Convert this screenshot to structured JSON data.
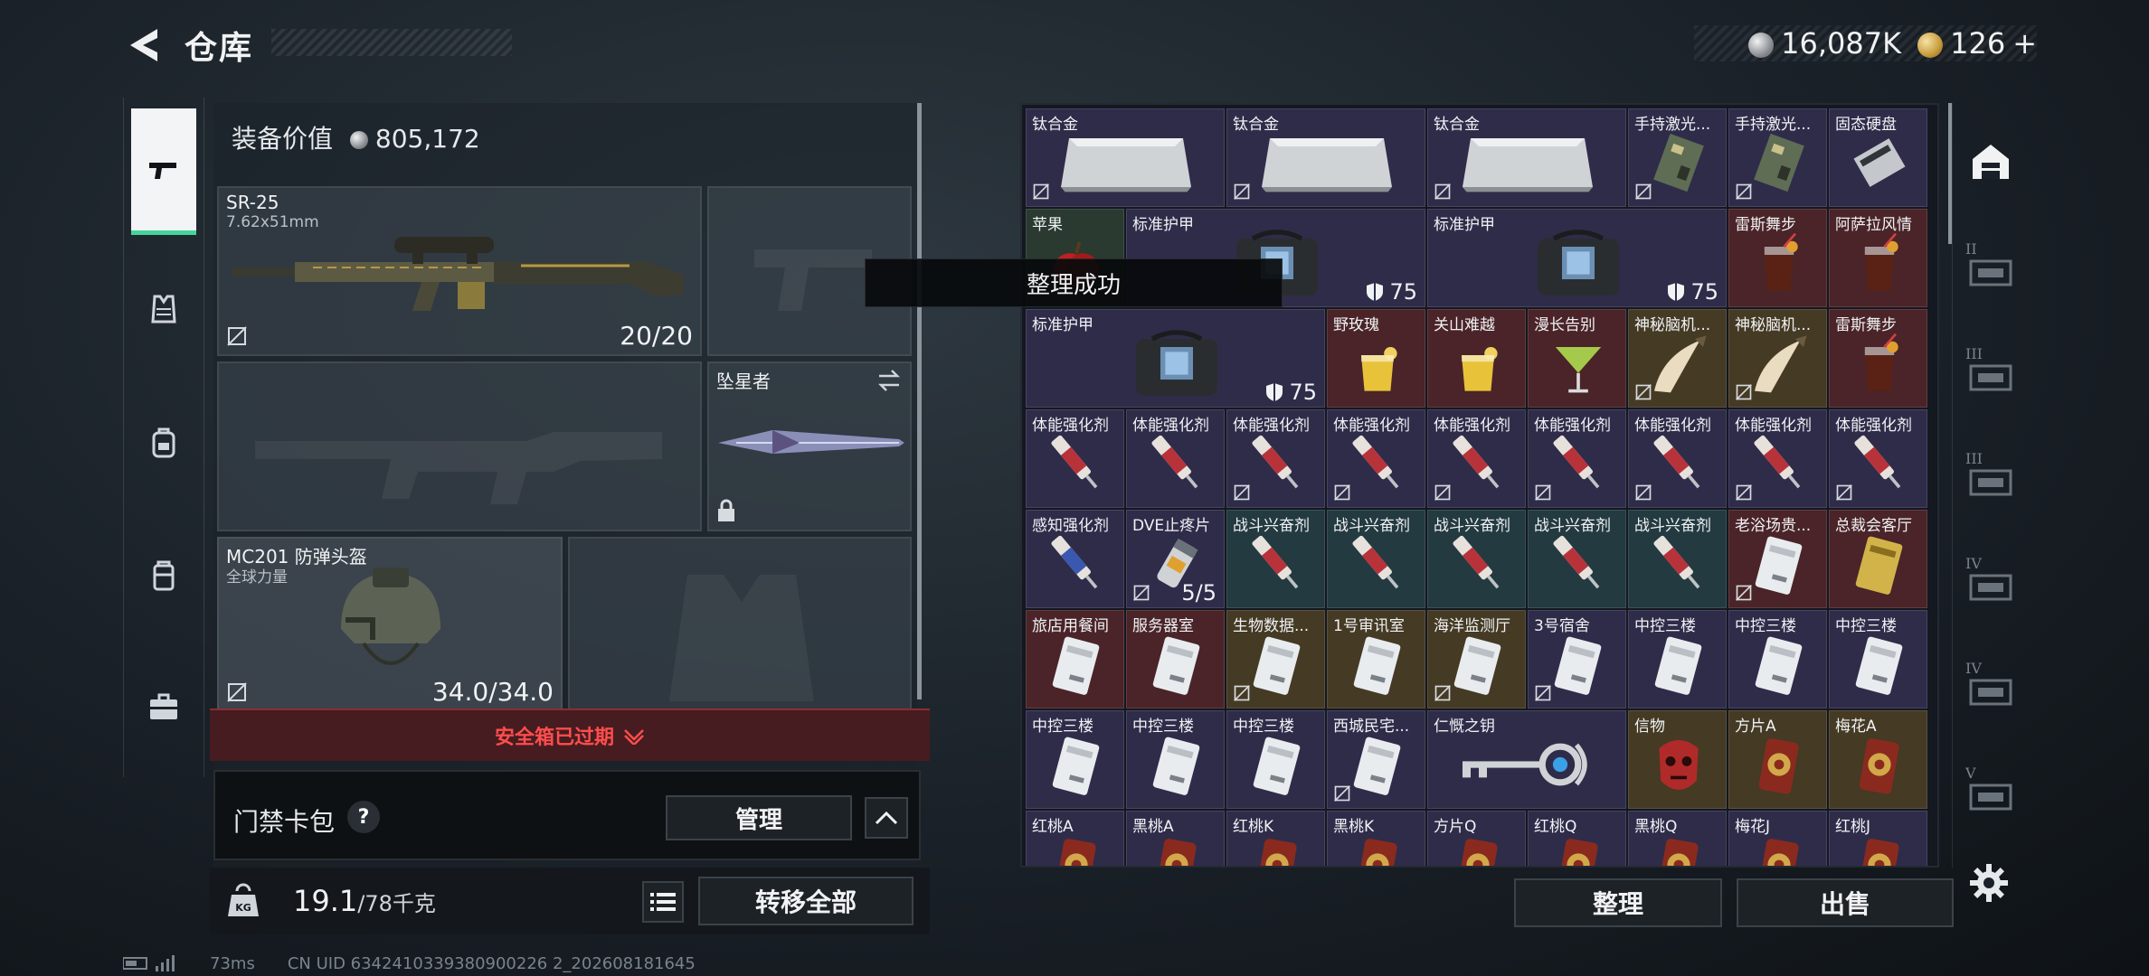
{
  "header": {
    "title": "仓库",
    "currency_silver": "16,087K",
    "currency_gold": "126",
    "add_symbol": "+"
  },
  "left_nav": [
    {
      "name": "weapon",
      "icon": "pistol-icon",
      "active": true
    },
    {
      "name": "armor",
      "icon": "vest-icon",
      "active": false
    },
    {
      "name": "backpack",
      "icon": "backpack-icon",
      "active": false
    },
    {
      "name": "rig",
      "icon": "rig-icon",
      "active": false
    },
    {
      "name": "case",
      "icon": "briefcase-icon",
      "active": false
    }
  ],
  "loadout": {
    "equip_value_label": "装备价值",
    "equip_value": "805,172",
    "primary": {
      "name": "SR-25",
      "caliber": "7.62x51mm",
      "ammo": "20/20"
    },
    "melee": {
      "name": "坠星者"
    },
    "helmet": {
      "name": "MC201 防弹头盔",
      "sub": "全球力量",
      "durability": "34.0/34.0"
    }
  },
  "safebox": {
    "label": "安全箱已过期"
  },
  "keycard": {
    "label": "门禁卡包",
    "help": "?",
    "manage": "管理"
  },
  "capacity": {
    "weight": "19.1",
    "max": "/78千克",
    "transfer_all": "转移全部"
  },
  "storage": {
    "toast": "整理成功",
    "sort": "整理",
    "sell": "出售",
    "items": [
      {
        "name": "钛合金",
        "count": "",
        "bg": "purple",
        "pic": "ingot",
        "noshare": true,
        "col": 0,
        "row": 0,
        "w": 2,
        "h": 1
      },
      {
        "name": "钛合金",
        "count": "",
        "bg": "purple",
        "pic": "ingot",
        "noshare": true,
        "col": 2,
        "row": 0,
        "w": 2,
        "h": 1
      },
      {
        "name": "钛合金",
        "count": "",
        "bg": "purple",
        "pic": "ingot",
        "noshare": true,
        "col": 4,
        "row": 0,
        "w": 2,
        "h": 1
      },
      {
        "name": "手持激光...",
        "count": "",
        "bg": "purple",
        "pic": "board",
        "noshare": true,
        "col": 6,
        "row": 0,
        "w": 1,
        "h": 1
      },
      {
        "name": "手持激光...",
        "count": "",
        "bg": "purple",
        "pic": "board",
        "noshare": true,
        "col": 7,
        "row": 0,
        "w": 1,
        "h": 1
      },
      {
        "name": "固态硬盘",
        "count": "",
        "bg": "purple",
        "pic": "ssd",
        "noshare": false,
        "col": 8,
        "row": 0,
        "w": 1,
        "h": 1
      },
      {
        "name": "苹果",
        "count": "",
        "bg": "green",
        "pic": "apple",
        "noshare": false,
        "col": 0,
        "row": 1,
        "w": 1,
        "h": 1
      },
      {
        "name": "标准护甲",
        "count": "75",
        "bg": "purple",
        "pic": "armor",
        "noshare": false,
        "col": 1,
        "row": 1,
        "w": 3,
        "h": 1
      },
      {
        "name": "标准护甲",
        "count": "75",
        "bg": "purple",
        "pic": "armor",
        "noshare": false,
        "col": 4,
        "row": 1,
        "w": 3,
        "h": 1
      },
      {
        "name": "雷斯舞步",
        "count": "",
        "bg": "red",
        "pic": "cocktail-dark",
        "noshare": false,
        "col": 7,
        "row": 1,
        "w": 1,
        "h": 1
      },
      {
        "name": "阿萨拉风情",
        "count": "",
        "bg": "red",
        "pic": "cocktail-dark",
        "noshare": false,
        "col": 8,
        "row": 1,
        "w": 1,
        "h": 1
      },
      {
        "name": "标准护甲",
        "count": "75",
        "bg": "purple",
        "pic": "armor",
        "noshare": false,
        "col": 0,
        "row": 2,
        "w": 3,
        "h": 1
      },
      {
        "name": "野玫瑰",
        "count": "",
        "bg": "red",
        "pic": "cocktail-yellow",
        "noshare": false,
        "col": 3,
        "row": 2,
        "w": 1,
        "h": 1
      },
      {
        "name": "关山难越",
        "count": "",
        "bg": "red",
        "pic": "cocktail-yellow",
        "noshare": false,
        "col": 4,
        "row": 2,
        "w": 1,
        "h": 1
      },
      {
        "name": "漫长告别",
        "count": "",
        "bg": "red",
        "pic": "martini",
        "noshare": false,
        "col": 5,
        "row": 2,
        "w": 1,
        "h": 1
      },
      {
        "name": "神秘脑机...",
        "count": "",
        "bg": "gold",
        "pic": "horn",
        "noshare": true,
        "col": 6,
        "row": 2,
        "w": 1,
        "h": 1
      },
      {
        "name": "神秘脑机...",
        "count": "",
        "bg": "gold",
        "pic": "horn",
        "noshare": true,
        "col": 7,
        "row": 2,
        "w": 1,
        "h": 1
      },
      {
        "name": "雷斯舞步",
        "count": "",
        "bg": "red",
        "pic": "cocktail-dark",
        "noshare": false,
        "col": 8,
        "row": 2,
        "w": 1,
        "h": 1
      },
      {
        "name": "体能强化剂",
        "count": "",
        "bg": "purple",
        "pic": "syringe-red",
        "noshare": false,
        "col": 0,
        "row": 3,
        "w": 1,
        "h": 1
      },
      {
        "name": "体能强化剂",
        "count": "",
        "bg": "purple",
        "pic": "syringe-red",
        "noshare": false,
        "col": 1,
        "row": 3,
        "w": 1,
        "h": 1
      },
      {
        "name": "体能强化剂",
        "count": "",
        "bg": "purple",
        "pic": "syringe-red",
        "noshare": true,
        "col": 2,
        "row": 3,
        "w": 1,
        "h": 1
      },
      {
        "name": "体能强化剂",
        "count": "",
        "bg": "purple",
        "pic": "syringe-red",
        "noshare": true,
        "col": 3,
        "row": 3,
        "w": 1,
        "h": 1
      },
      {
        "name": "体能强化剂",
        "count": "",
        "bg": "purple",
        "pic": "syringe-red",
        "noshare": true,
        "col": 4,
        "row": 3,
        "w": 1,
        "h": 1
      },
      {
        "name": "体能强化剂",
        "count": "",
        "bg": "purple",
        "pic": "syringe-red",
        "noshare": true,
        "col": 5,
        "row": 3,
        "w": 1,
        "h": 1
      },
      {
        "name": "体能强化剂",
        "count": "",
        "bg": "purple",
        "pic": "syringe-red",
        "noshare": true,
        "col": 6,
        "row": 3,
        "w": 1,
        "h": 1
      },
      {
        "name": "体能强化剂",
        "count": "",
        "bg": "purple",
        "pic": "syringe-red",
        "noshare": true,
        "col": 7,
        "row": 3,
        "w": 1,
        "h": 1
      },
      {
        "name": "体能强化剂",
        "count": "",
        "bg": "purple",
        "pic": "syringe-red",
        "noshare": true,
        "col": 8,
        "row": 3,
        "w": 1,
        "h": 1
      },
      {
        "name": "感知强化剂",
        "count": "",
        "bg": "purple",
        "pic": "syringe-blue",
        "noshare": false,
        "col": 0,
        "row": 4,
        "w": 1,
        "h": 1
      },
      {
        "name": "DVE止疼片",
        "count": "5/5",
        "bg": "purple",
        "pic": "pills",
        "noshare": true,
        "col": 1,
        "row": 4,
        "w": 1,
        "h": 1
      },
      {
        "name": "战斗兴奋剂",
        "count": "",
        "bg": "teal",
        "pic": "syringe-red",
        "noshare": false,
        "col": 2,
        "row": 4,
        "w": 1,
        "h": 1
      },
      {
        "name": "战斗兴奋剂",
        "count": "",
        "bg": "teal",
        "pic": "syringe-red",
        "noshare": false,
        "col": 3,
        "row": 4,
        "w": 1,
        "h": 1
      },
      {
        "name": "战斗兴奋剂",
        "count": "",
        "bg": "teal",
        "pic": "syringe-red",
        "noshare": false,
        "col": 4,
        "row": 4,
        "w": 1,
        "h": 1
      },
      {
        "name": "战斗兴奋剂",
        "count": "",
        "bg": "teal",
        "pic": "syringe-red",
        "noshare": false,
        "col": 5,
        "row": 4,
        "w": 1,
        "h": 1
      },
      {
        "name": "战斗兴奋剂",
        "count": "",
        "bg": "teal",
        "pic": "syringe-red",
        "noshare": false,
        "col": 6,
        "row": 4,
        "w": 1,
        "h": 1
      },
      {
        "name": "老浴场贵...",
        "count": "",
        "bg": "red",
        "pic": "card-white",
        "noshare": true,
        "col": 7,
        "row": 4,
        "w": 1,
        "h": 1
      },
      {
        "name": "总裁会客厅",
        "count": "",
        "bg": "red",
        "pic": "card-gold",
        "noshare": false,
        "col": 8,
        "row": 4,
        "w": 1,
        "h": 1
      },
      {
        "name": "旅店用餐间",
        "count": "",
        "bg": "red",
        "pic": "card-white",
        "noshare": false,
        "col": 0,
        "row": 5,
        "w": 1,
        "h": 1
      },
      {
        "name": "服务器室",
        "count": "",
        "bg": "red",
        "pic": "card-white",
        "noshare": false,
        "col": 1,
        "row": 5,
        "w": 1,
        "h": 1
      },
      {
        "name": "生物数据...",
        "count": "",
        "bg": "gold",
        "pic": "card-white",
        "noshare": true,
        "col": 2,
        "row": 5,
        "w": 1,
        "h": 1
      },
      {
        "name": "1号审讯室",
        "count": "",
        "bg": "gold",
        "pic": "card-white",
        "noshare": false,
        "col": 3,
        "row": 5,
        "w": 1,
        "h": 1
      },
      {
        "name": "海洋监测厅",
        "count": "",
        "bg": "gold",
        "pic": "card-white",
        "noshare": true,
        "col": 4,
        "row": 5,
        "w": 1,
        "h": 1
      },
      {
        "name": "3号宿舍",
        "count": "",
        "bg": "purple",
        "pic": "card-white",
        "noshare": true,
        "col": 5,
        "row": 5,
        "w": 1,
        "h": 1
      },
      {
        "name": "中控三楼",
        "count": "",
        "bg": "purple",
        "pic": "card-white",
        "noshare": false,
        "col": 6,
        "row": 5,
        "w": 1,
        "h": 1
      },
      {
        "name": "中控三楼",
        "count": "",
        "bg": "purple",
        "pic": "card-white",
        "noshare": false,
        "col": 7,
        "row": 5,
        "w": 1,
        "h": 1
      },
      {
        "name": "中控三楼",
        "count": "",
        "bg": "purple",
        "pic": "card-white",
        "noshare": false,
        "col": 8,
        "row": 5,
        "w": 1,
        "h": 1
      },
      {
        "name": "中控三楼",
        "count": "",
        "bg": "purple",
        "pic": "card-white",
        "noshare": false,
        "col": 0,
        "row": 6,
        "w": 1,
        "h": 1
      },
      {
        "name": "中控三楼",
        "count": "",
        "bg": "purple",
        "pic": "card-white",
        "noshare": false,
        "col": 1,
        "row": 6,
        "w": 1,
        "h": 1
      },
      {
        "name": "中控三楼",
        "count": "",
        "bg": "purple",
        "pic": "card-white",
        "noshare": false,
        "col": 2,
        "row": 6,
        "w": 1,
        "h": 1
      },
      {
        "name": "西城民宅...",
        "count": "",
        "bg": "purple",
        "pic": "card-white",
        "noshare": true,
        "col": 3,
        "row": 6,
        "w": 1,
        "h": 1
      },
      {
        "name": "仁慨之钥",
        "count": "",
        "bg": "purple",
        "pic": "key",
        "noshare": false,
        "col": 4,
        "row": 6,
        "w": 2,
        "h": 1
      },
      {
        "name": "信物",
        "count": "",
        "bg": "gold",
        "pic": "mask",
        "noshare": false,
        "col": 6,
        "row": 6,
        "w": 1,
        "h": 1
      },
      {
        "name": "方片A",
        "count": "",
        "bg": "gold",
        "pic": "badge",
        "noshare": false,
        "col": 7,
        "row": 6,
        "w": 1,
        "h": 1
      },
      {
        "name": "梅花A",
        "count": "",
        "bg": "gold",
        "pic": "badge",
        "noshare": false,
        "col": 8,
        "row": 6,
        "w": 1,
        "h": 1
      },
      {
        "name": "红桃A",
        "count": "",
        "bg": "purple",
        "pic": "badge",
        "noshare": false,
        "col": 0,
        "row": 7,
        "w": 1,
        "h": 1
      },
      {
        "name": "黑桃A",
        "count": "",
        "bg": "purple",
        "pic": "badge",
        "noshare": false,
        "col": 1,
        "row": 7,
        "w": 1,
        "h": 1
      },
      {
        "name": "红桃K",
        "count": "",
        "bg": "purple",
        "pic": "badge",
        "noshare": false,
        "col": 2,
        "row": 7,
        "w": 1,
        "h": 1
      },
      {
        "name": "黑桃K",
        "count": "",
        "bg": "purple",
        "pic": "badge",
        "noshare": false,
        "col": 3,
        "row": 7,
        "w": 1,
        "h": 1
      },
      {
        "name": "方片Q",
        "count": "",
        "bg": "purple",
        "pic": "badge",
        "noshare": false,
        "col": 4,
        "row": 7,
        "w": 1,
        "h": 1
      },
      {
        "name": "红桃Q",
        "count": "",
        "bg": "purple",
        "pic": "badge",
        "noshare": false,
        "col": 5,
        "row": 7,
        "w": 1,
        "h": 1
      },
      {
        "name": "黑桃Q",
        "count": "",
        "bg": "purple",
        "pic": "badge",
        "noshare": false,
        "col": 6,
        "row": 7,
        "w": 1,
        "h": 1
      },
      {
        "name": "梅花J",
        "count": "",
        "bg": "purple",
        "pic": "badge",
        "noshare": false,
        "col": 7,
        "row": 7,
        "w": 1,
        "h": 1
      },
      {
        "name": "红桃J",
        "count": "",
        "bg": "purple",
        "pic": "badge",
        "noshare": false,
        "col": 8,
        "row": 7,
        "w": 1,
        "h": 1
      }
    ]
  },
  "right_rail": [
    {
      "icon": "storage-home-icon",
      "label": ""
    },
    {
      "icon": "shelf-2-icon",
      "label": "II"
    },
    {
      "icon": "shelf-3-icon",
      "label": "III"
    },
    {
      "icon": "shelf-3b-icon",
      "label": "III"
    },
    {
      "icon": "shelf-4-icon",
      "label": "IV"
    },
    {
      "icon": "shelf-4b-icon",
      "label": "IV"
    },
    {
      "icon": "shelf-5-icon",
      "label": "V"
    }
  ],
  "status": {
    "ping": "73ms",
    "uid": "CN UID 6342410339380900226 2_202608181645"
  },
  "colors": {
    "accent_green": "#45d39c",
    "danger_red": "#ff4d4d",
    "rarity_red": "#4a2428",
    "rarity_gold": "#453a24",
    "rarity_purple": "#2a2f4a"
  }
}
